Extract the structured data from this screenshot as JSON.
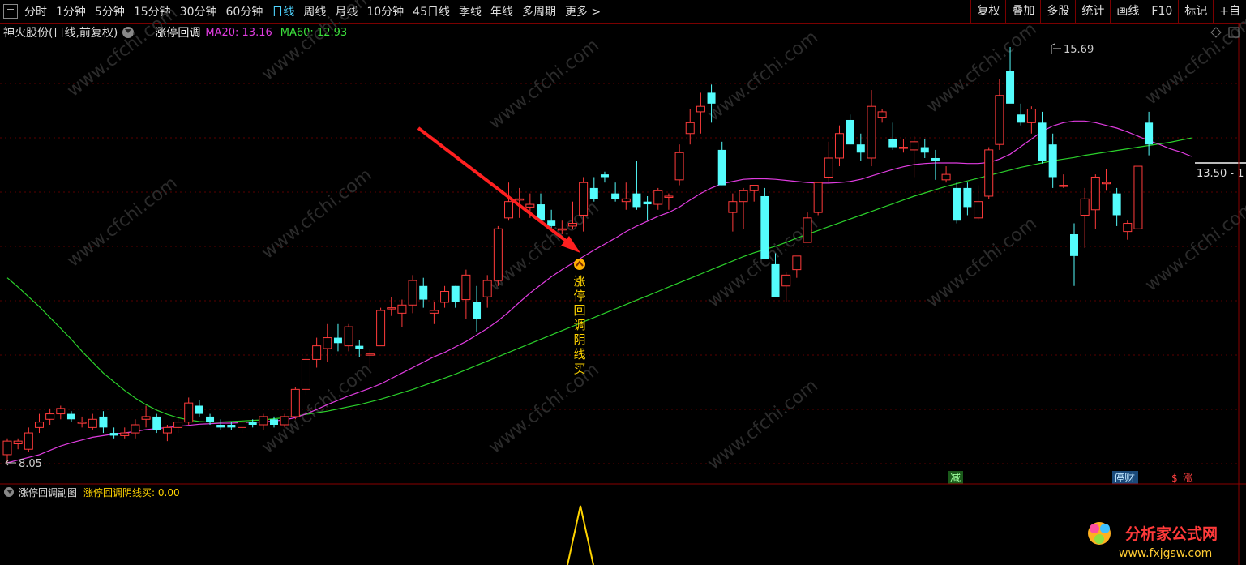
{
  "toolbar": {
    "periods": [
      "分时",
      "1分钟",
      "5分钟",
      "15分钟",
      "30分钟",
      "60分钟",
      "日线",
      "周线",
      "月线",
      "10分钟",
      "45日线",
      "季线",
      "年线",
      "多周期",
      "更多 >"
    ],
    "active_period": "日线",
    "right_buttons": [
      "复权",
      "叠加",
      "多股",
      "统计",
      "画线",
      "F10",
      "标记",
      "+自"
    ]
  },
  "header": {
    "stock": "神火股份(日线,前复权)",
    "indicator": "涨停回调",
    "ma20": "MA20: 13.16",
    "ma60": "MA60: 12.93"
  },
  "chart_labels": {
    "high": "15.69",
    "low": "8.05",
    "price_tag": "13.50 - 1",
    "signal_text": "涨停回调阴线买",
    "event_reduce": "减",
    "event_suspend": "停财",
    "event_rise": "涨",
    "event_dollar": "$",
    "watermark": "www.cfchi.com"
  },
  "sub_panel": {
    "title": "涨停回调副图",
    "value_label": "涨停回调阴线买: 0.00"
  },
  "logo": {
    "name": "分析家公式网",
    "url": "www.fxjgsw.com"
  },
  "colors": {
    "up": "#ff3b3b",
    "down": "#54fcfc",
    "ma20": "#e03ce0",
    "ma60": "#2bd02b",
    "arrow": "#ff2020",
    "signal": "#ffd400"
  },
  "chart_data": {
    "type": "candlestick",
    "price_extremes": {
      "high": 15.69,
      "low": 8.05
    },
    "candles": [
      {
        "o": 8.2,
        "h": 8.5,
        "l": 8.05,
        "c": 8.45
      },
      {
        "o": 8.4,
        "h": 8.5,
        "l": 8.3,
        "c": 8.45
      },
      {
        "o": 8.3,
        "h": 8.7,
        "l": 8.25,
        "c": 8.6
      },
      {
        "o": 8.7,
        "h": 8.95,
        "l": 8.6,
        "c": 8.8
      },
      {
        "o": 8.85,
        "h": 9.05,
        "l": 8.75,
        "c": 8.95
      },
      {
        "o": 8.95,
        "h": 9.1,
        "l": 8.85,
        "c": 9.05
      },
      {
        "o": 8.95,
        "h": 9.0,
        "l": 8.8,
        "c": 8.85
      },
      {
        "o": 8.8,
        "h": 8.9,
        "l": 8.7,
        "c": 8.8
      },
      {
        "o": 8.7,
        "h": 8.95,
        "l": 8.65,
        "c": 8.85
      },
      {
        "o": 8.9,
        "h": 9.0,
        "l": 8.6,
        "c": 8.7
      },
      {
        "o": 8.6,
        "h": 8.7,
        "l": 8.5,
        "c": 8.55
      },
      {
        "o": 8.55,
        "h": 8.7,
        "l": 8.5,
        "c": 8.6
      },
      {
        "o": 8.6,
        "h": 8.85,
        "l": 8.5,
        "c": 8.75
      },
      {
        "o": 8.85,
        "h": 9.1,
        "l": 8.7,
        "c": 8.9
      },
      {
        "o": 8.9,
        "h": 8.95,
        "l": 8.6,
        "c": 8.65
      },
      {
        "o": 8.6,
        "h": 8.75,
        "l": 8.45,
        "c": 8.7
      },
      {
        "o": 8.7,
        "h": 8.9,
        "l": 8.6,
        "c": 8.8
      },
      {
        "o": 8.8,
        "h": 9.25,
        "l": 8.75,
        "c": 9.15
      },
      {
        "o": 9.1,
        "h": 9.2,
        "l": 8.9,
        "c": 8.95
      },
      {
        "o": 8.9,
        "h": 8.95,
        "l": 8.75,
        "c": 8.8
      },
      {
        "o": 8.75,
        "h": 8.85,
        "l": 8.65,
        "c": 8.7
      },
      {
        "o": 8.75,
        "h": 8.8,
        "l": 8.65,
        "c": 8.7
      },
      {
        "o": 8.7,
        "h": 8.85,
        "l": 8.6,
        "c": 8.8
      },
      {
        "o": 8.8,
        "h": 8.85,
        "l": 8.7,
        "c": 8.75
      },
      {
        "o": 8.75,
        "h": 8.95,
        "l": 8.65,
        "c": 8.9
      },
      {
        "o": 8.85,
        "h": 8.9,
        "l": 8.7,
        "c": 8.75
      },
      {
        "o": 8.75,
        "h": 8.95,
        "l": 8.7,
        "c": 8.9
      },
      {
        "o": 8.9,
        "h": 9.45,
        "l": 8.85,
        "c": 9.4
      },
      {
        "o": 9.4,
        "h": 10.1,
        "l": 9.3,
        "c": 9.95
      },
      {
        "o": 9.95,
        "h": 10.35,
        "l": 9.8,
        "c": 10.2
      },
      {
        "o": 10.15,
        "h": 10.6,
        "l": 9.9,
        "c": 10.35
      },
      {
        "o": 10.35,
        "h": 10.6,
        "l": 10.1,
        "c": 10.25
      },
      {
        "o": 10.2,
        "h": 10.6,
        "l": 10.1,
        "c": 10.55
      },
      {
        "o": 10.2,
        "h": 10.3,
        "l": 10.0,
        "c": 10.15
      },
      {
        "o": 10.05,
        "h": 10.15,
        "l": 9.8,
        "c": 10.05
      },
      {
        "o": 10.2,
        "h": 10.9,
        "l": 10.2,
        "c": 10.85
      },
      {
        "o": 10.9,
        "h": 11.1,
        "l": 10.75,
        "c": 10.9
      },
      {
        "o": 10.8,
        "h": 11.05,
        "l": 10.55,
        "c": 10.95
      },
      {
        "o": 10.95,
        "h": 11.5,
        "l": 10.8,
        "c": 11.4
      },
      {
        "o": 11.3,
        "h": 11.45,
        "l": 10.9,
        "c": 11.05
      },
      {
        "o": 10.8,
        "h": 11.0,
        "l": 10.6,
        "c": 10.85
      },
      {
        "o": 11.0,
        "h": 11.3,
        "l": 10.9,
        "c": 11.2
      },
      {
        "o": 11.3,
        "h": 11.3,
        "l": 10.9,
        "c": 11.0
      },
      {
        "o": 11.05,
        "h": 11.6,
        "l": 10.7,
        "c": 11.5
      },
      {
        "o": 11.0,
        "h": 11.3,
        "l": 10.45,
        "c": 10.7
      },
      {
        "o": 11.1,
        "h": 11.5,
        "l": 10.9,
        "c": 11.4
      },
      {
        "o": 11.4,
        "h": 12.4,
        "l": 11.3,
        "c": 12.35
      },
      {
        "o": 12.55,
        "h": 13.2,
        "l": 12.5,
        "c": 12.85
      },
      {
        "o": 12.9,
        "h": 13.1,
        "l": 12.55,
        "c": 12.9
      },
      {
        "o": 12.75,
        "h": 13.0,
        "l": 12.55,
        "c": 12.8
      },
      {
        "o": 12.8,
        "h": 13.0,
        "l": 12.45,
        "c": 12.5
      },
      {
        "o": 12.5,
        "h": 12.7,
        "l": 12.35,
        "c": 12.4
      },
      {
        "o": 12.35,
        "h": 12.5,
        "l": 12.25,
        "c": 12.35
      },
      {
        "o": 12.4,
        "h": 12.85,
        "l": 12.35,
        "c": 12.45
      },
      {
        "o": 12.6,
        "h": 13.3,
        "l": 12.3,
        "c": 13.2
      },
      {
        "o": 13.1,
        "h": 13.3,
        "l": 12.85,
        "c": 12.9
      },
      {
        "o": 13.35,
        "h": 13.4,
        "l": 13.2,
        "c": 13.3
      },
      {
        "o": 13.0,
        "h": 13.2,
        "l": 12.85,
        "c": 12.9
      },
      {
        "o": 12.85,
        "h": 13.2,
        "l": 12.7,
        "c": 12.9
      },
      {
        "o": 13.0,
        "h": 13.6,
        "l": 12.7,
        "c": 12.75
      },
      {
        "o": 12.85,
        "h": 12.95,
        "l": 12.5,
        "c": 12.8
      },
      {
        "o": 12.8,
        "h": 13.1,
        "l": 12.7,
        "c": 13.05
      },
      {
        "o": 12.95,
        "h": 13.0,
        "l": 12.7,
        "c": 12.95
      },
      {
        "o": 13.25,
        "h": 13.9,
        "l": 13.15,
        "c": 13.75
      },
      {
        "o": 14.1,
        "h": 14.55,
        "l": 13.9,
        "c": 14.3
      },
      {
        "o": 14.5,
        "h": 14.85,
        "l": 14.1,
        "c": 14.6
      },
      {
        "o": 14.85,
        "h": 15.0,
        "l": 14.3,
        "c": 14.65
      },
      {
        "o": 13.8,
        "h": 13.95,
        "l": 13.15,
        "c": 13.15
      },
      {
        "o": 12.65,
        "h": 13.0,
        "l": 12.3,
        "c": 12.85
      },
      {
        "o": 12.85,
        "h": 13.1,
        "l": 12.35,
        "c": 13.05
      },
      {
        "o": 13.05,
        "h": 13.15,
        "l": 12.85,
        "c": 13.15
      },
      {
        "o": 12.95,
        "h": 13.1,
        "l": 11.8,
        "c": 11.8
      },
      {
        "o": 11.7,
        "h": 11.9,
        "l": 11.15,
        "c": 11.1
      },
      {
        "o": 11.3,
        "h": 11.55,
        "l": 11.0,
        "c": 11.5
      },
      {
        "o": 11.6,
        "h": 11.85,
        "l": 11.45,
        "c": 11.85
      },
      {
        "o": 12.1,
        "h": 12.65,
        "l": 12.1,
        "c": 12.55
      },
      {
        "o": 12.65,
        "h": 13.2,
        "l": 12.6,
        "c": 13.2
      },
      {
        "o": 13.3,
        "h": 13.95,
        "l": 13.2,
        "c": 13.65
      },
      {
        "o": 13.65,
        "h": 14.25,
        "l": 13.5,
        "c": 14.1
      },
      {
        "o": 14.35,
        "h": 14.45,
        "l": 13.9,
        "c": 13.9
      },
      {
        "o": 13.9,
        "h": 14.1,
        "l": 13.6,
        "c": 13.75
      },
      {
        "o": 13.65,
        "h": 14.9,
        "l": 13.5,
        "c": 14.6
      },
      {
        "o": 14.4,
        "h": 14.55,
        "l": 14.3,
        "c": 14.5
      },
      {
        "o": 14.0,
        "h": 14.3,
        "l": 13.8,
        "c": 13.85
      },
      {
        "o": 13.85,
        "h": 14.0,
        "l": 13.75,
        "c": 13.85
      },
      {
        "o": 13.8,
        "h": 14.05,
        "l": 13.3,
        "c": 13.95
      },
      {
        "o": 13.85,
        "h": 14.0,
        "l": 13.65,
        "c": 13.75
      },
      {
        "o": 13.65,
        "h": 13.8,
        "l": 13.25,
        "c": 13.6
      },
      {
        "o": 13.25,
        "h": 13.5,
        "l": 13.2,
        "c": 13.35
      },
      {
        "o": 13.1,
        "h": 13.2,
        "l": 12.45,
        "c": 12.5
      },
      {
        "o": 13.1,
        "h": 13.2,
        "l": 12.6,
        "c": 12.75
      },
      {
        "o": 12.55,
        "h": 13.15,
        "l": 12.5,
        "c": 12.85
      },
      {
        "o": 12.95,
        "h": 13.85,
        "l": 12.9,
        "c": 13.8
      },
      {
        "o": 13.9,
        "h": 15.1,
        "l": 13.8,
        "c": 14.8
      },
      {
        "o": 15.25,
        "h": 15.69,
        "l": 14.8,
        "c": 14.65
      },
      {
        "o": 14.45,
        "h": 14.65,
        "l": 14.25,
        "c": 14.3
      },
      {
        "o": 14.3,
        "h": 14.6,
        "l": 14.1,
        "c": 14.55
      },
      {
        "o": 14.3,
        "h": 14.5,
        "l": 13.55,
        "c": 13.6
      },
      {
        "o": 13.9,
        "h": 14.1,
        "l": 13.1,
        "c": 13.3
      },
      {
        "o": 13.15,
        "h": 13.35,
        "l": 13.1,
        "c": 13.15
      },
      {
        "o": 12.25,
        "h": 12.45,
        "l": 11.3,
        "c": 11.85
      },
      {
        "o": 12.6,
        "h": 13.1,
        "l": 12.0,
        "c": 12.9
      },
      {
        "o": 12.7,
        "h": 13.35,
        "l": 12.35,
        "c": 13.3
      },
      {
        "o": 13.2,
        "h": 13.45,
        "l": 13.05,
        "c": 13.2
      },
      {
        "o": 13.0,
        "h": 13.1,
        "l": 12.4,
        "c": 12.6
      },
      {
        "o": 12.3,
        "h": 12.5,
        "l": 12.15,
        "c": 12.45
      },
      {
        "o": 12.35,
        "h": 13.1,
        "l": 12.35,
        "c": 13.5
      },
      {
        "o": 14.3,
        "h": 14.5,
        "l": 13.7,
        "c": 13.9
      }
    ],
    "ma20": [
      8.05,
      8.1,
      8.15,
      8.2,
      8.28,
      8.36,
      8.42,
      8.47,
      8.52,
      8.55,
      8.58,
      8.6,
      8.63,
      8.66,
      8.68,
      8.7,
      8.72,
      8.74,
      8.76,
      8.77,
      8.78,
      8.78,
      8.79,
      8.8,
      8.8,
      8.82,
      8.84,
      8.88,
      8.95,
      9.03,
      9.12,
      9.2,
      9.28,
      9.35,
      9.42,
      9.5,
      9.6,
      9.7,
      9.8,
      9.9,
      10.0,
      10.08,
      10.18,
      10.28,
      10.4,
      10.52,
      10.66,
      10.82,
      11.0,
      11.17,
      11.32,
      11.47,
      11.6,
      11.72,
      11.84,
      11.96,
      12.07,
      12.18,
      12.3,
      12.4,
      12.49,
      12.58,
      12.65,
      12.75,
      12.88,
      13.0,
      13.1,
      13.18,
      13.22,
      13.26,
      13.27,
      13.27,
      13.26,
      13.24,
      13.22,
      13.2,
      13.19,
      13.19,
      13.2,
      13.22,
      13.26,
      13.32,
      13.38,
      13.44,
      13.49,
      13.53,
      13.55,
      13.56,
      13.56,
      13.56,
      13.55,
      13.55,
      13.57,
      13.63,
      13.72,
      13.86,
      14.0,
      14.14,
      14.24,
      14.3,
      14.33,
      14.33,
      14.3,
      14.25,
      14.2,
      14.13,
      14.05,
      13.97,
      13.9,
      13.82,
      13.76,
      13.68
    ],
    "ma60": [
      11.45,
      11.28,
      11.1,
      10.92,
      10.72,
      10.52,
      10.32,
      10.1,
      9.9,
      9.7,
      9.54,
      9.38,
      9.24,
      9.12,
      9.02,
      8.94,
      8.88,
      8.84,
      8.81,
      8.8,
      8.8,
      8.81,
      8.82,
      8.83,
      8.84,
      8.86,
      8.88,
      8.91,
      8.94,
      8.97,
      9.0,
      9.04,
      9.08,
      9.12,
      9.17,
      9.22,
      9.28,
      9.34,
      9.4,
      9.47,
      9.54,
      9.61,
      9.68,
      9.76,
      9.84,
      9.92,
      10.0,
      10.08,
      10.16,
      10.24,
      10.32,
      10.4,
      10.48,
      10.56,
      10.64,
      10.72,
      10.8,
      10.88,
      10.96,
      11.04,
      11.12,
      11.2,
      11.28,
      11.36,
      11.44,
      11.52,
      11.6,
      11.68,
      11.76,
      11.84,
      11.91,
      11.97,
      12.03,
      12.1,
      12.18,
      12.25,
      12.32,
      12.39,
      12.46,
      12.53,
      12.6,
      12.67,
      12.74,
      12.81,
      12.88,
      12.95,
      13.01,
      13.07,
      13.13,
      13.18,
      13.23,
      13.28,
      13.33,
      13.38,
      13.43,
      13.48,
      13.52,
      13.56,
      13.6,
      13.63,
      13.66,
      13.7,
      13.73,
      13.76,
      13.79,
      13.82,
      13.85,
      13.88,
      13.91,
      13.94,
      13.98,
      14.02
    ],
    "sub_indicator": {
      "name": "涨停回调阴线买",
      "value": 0.0
    }
  }
}
